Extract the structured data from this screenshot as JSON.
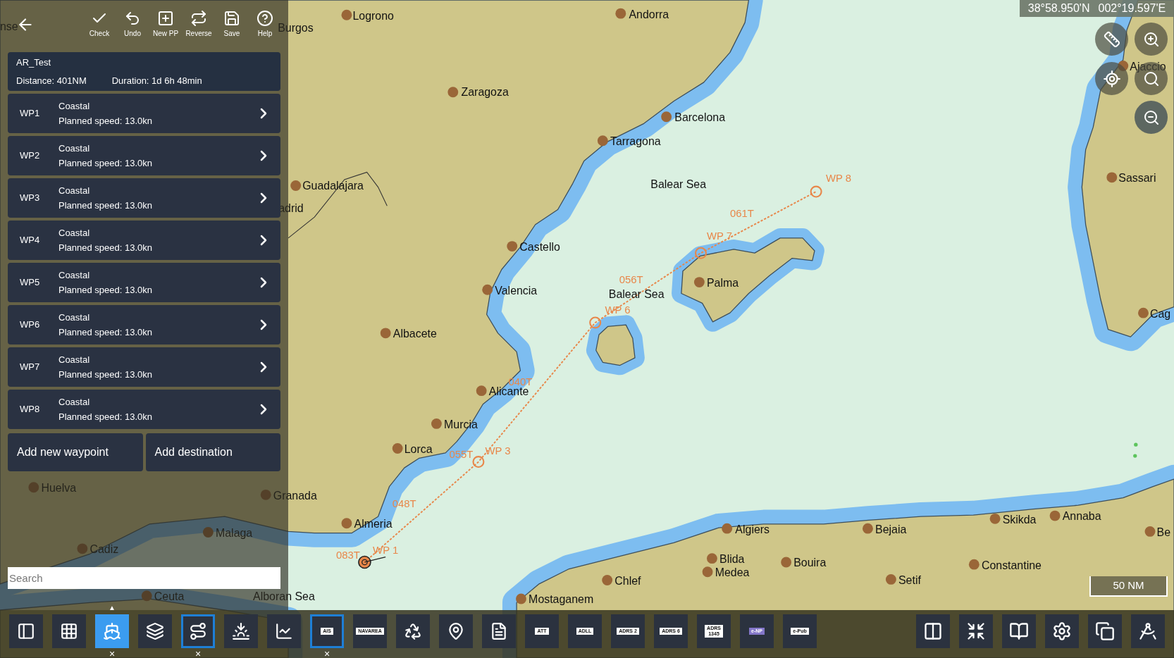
{
  "toolbar": {
    "buttons": [
      {
        "label": "Check"
      },
      {
        "label": "Undo"
      },
      {
        "label": "New PP"
      },
      {
        "label": "Reverse"
      },
      {
        "label": "Save"
      },
      {
        "label": "Help"
      }
    ]
  },
  "route": {
    "name": "AR_Test",
    "distance": "Distance: 401NM",
    "duration": "Duration: 1d 6h 48min"
  },
  "waypoints": [
    {
      "name": "WP1",
      "type": "Coastal",
      "speed": "Planned speed: 13.0kn"
    },
    {
      "name": "WP2",
      "type": "Coastal",
      "speed": "Planned speed: 13.0kn"
    },
    {
      "name": "WP3",
      "type": "Coastal",
      "speed": "Planned speed: 13.0kn"
    },
    {
      "name": "WP4",
      "type": "Coastal",
      "speed": "Planned speed: 13.0kn"
    },
    {
      "name": "WP5",
      "type": "Coastal",
      "speed": "Planned speed: 13.0kn"
    },
    {
      "name": "WP6",
      "type": "Coastal",
      "speed": "Planned speed: 13.0kn"
    },
    {
      "name": "WP7",
      "type": "Coastal",
      "speed": "Planned speed: 13.0kn"
    },
    {
      "name": "WP8",
      "type": "Coastal",
      "speed": "Planned speed: 13.0kn"
    }
  ],
  "actions": [
    "Add new waypoint",
    "Add destination"
  ],
  "search": {
    "placeholder": "Search"
  },
  "position": {
    "latitude": "38°58.950'N",
    "longitude": "002°19.597'E"
  },
  "map": {
    "places": [
      {
        "name": "Logrono",
        "kind": "city"
      },
      {
        "name": "Andorra",
        "kind": "city"
      },
      {
        "name": "Burgos",
        "kind": "label"
      },
      {
        "name": "nse",
        "kind": "label"
      },
      {
        "name": "Ajaccio",
        "kind": "city"
      },
      {
        "name": "Zaragoza",
        "kind": "city"
      },
      {
        "name": "Barcelona",
        "kind": "city"
      },
      {
        "name": "Tarragona",
        "kind": "city"
      },
      {
        "name": "Guadalajara",
        "kind": "city"
      },
      {
        "name": "adrid",
        "kind": "label"
      },
      {
        "name": "Castello",
        "kind": "city"
      },
      {
        "name": "Valencia",
        "kind": "city"
      },
      {
        "name": "Albacete",
        "kind": "city"
      },
      {
        "name": "Alicante",
        "kind": "city"
      },
      {
        "name": "Murcia",
        "kind": "city"
      },
      {
        "name": "Lorca",
        "kind": "city"
      },
      {
        "name": "Granada",
        "kind": "city"
      },
      {
        "name": "Huelva",
        "kind": "city"
      },
      {
        "name": "Almeria",
        "kind": "city"
      },
      {
        "name": "Malaga",
        "kind": "city"
      },
      {
        "name": "Cadiz",
        "kind": "city"
      },
      {
        "name": "Ceuta",
        "kind": "city"
      },
      {
        "name": "Alboran Sea",
        "kind": "sea"
      },
      {
        "name": "Mostaganem",
        "kind": "city"
      },
      {
        "name": "Chlef",
        "kind": "city"
      },
      {
        "name": "Blida",
        "kind": "city"
      },
      {
        "name": "Medea",
        "kind": "city"
      },
      {
        "name": "Algiers",
        "kind": "city"
      },
      {
        "name": "Bouira",
        "kind": "city"
      },
      {
        "name": "Bejaia",
        "kind": "city"
      },
      {
        "name": "Setif",
        "kind": "city"
      },
      {
        "name": "Constantine",
        "kind": "city"
      },
      {
        "name": "Skikda",
        "kind": "city"
      },
      {
        "name": "Annaba",
        "kind": "city"
      },
      {
        "name": "Be",
        "kind": "city"
      },
      {
        "name": "Sassari",
        "kind": "city"
      },
      {
        "name": "Cag",
        "kind": "city"
      },
      {
        "name": "Palma",
        "kind": "city"
      },
      {
        "name": "Balear Sea",
        "kind": "sea"
      },
      {
        "name": "Balear Sea",
        "kind": "sea"
      }
    ],
    "route_labels": [
      "083T",
      "WP 1",
      "048T",
      "055T",
      "WP 3",
      "040T",
      "WP 6",
      "056T",
      "WP 7",
      "061T",
      "WP 8"
    ]
  },
  "scale": "50 NM",
  "bottom_toolbar": {
    "left": [
      {
        "kind": "icon",
        "selected": false,
        "active": false
      },
      {
        "kind": "icon",
        "selected": false,
        "active": false
      },
      {
        "kind": "icon",
        "selected": true,
        "active": false,
        "above": "▲",
        "close": "×"
      },
      {
        "kind": "icon",
        "selected": false,
        "active": false
      },
      {
        "kind": "icon",
        "selected": false,
        "active": true,
        "close": "×"
      },
      {
        "kind": "icon",
        "selected": false,
        "active": false
      },
      {
        "kind": "icon",
        "selected": false,
        "active": false
      },
      {
        "kind": "tag",
        "label": "AIS",
        "color": "#ffffff",
        "selected": false,
        "active": true,
        "close": "×"
      },
      {
        "kind": "tag",
        "label": "NAVAREA",
        "color": "#ffffff",
        "selected": false,
        "active": false
      },
      {
        "kind": "icon",
        "selected": false,
        "active": false
      },
      {
        "kind": "icon",
        "selected": false,
        "active": false
      },
      {
        "kind": "icon",
        "selected": false,
        "active": false
      },
      {
        "kind": "tag",
        "label": "ATT",
        "color": "#ffffff",
        "selected": false,
        "active": false
      },
      {
        "kind": "tag",
        "label": "ADLL",
        "color": "#ffffff",
        "selected": false,
        "active": false
      },
      {
        "kind": "tag",
        "label": "ADRS 2",
        "color": "#ffffff",
        "selected": false,
        "active": false
      },
      {
        "kind": "tag",
        "label": "ADRS 6",
        "color": "#ffffff",
        "selected": false,
        "active": false
      },
      {
        "kind": "tag",
        "label": "ADRS\n1345",
        "color": "#ffffff",
        "selected": false,
        "active": false
      },
      {
        "kind": "tag",
        "label": "e-NP",
        "color": "#8477c9",
        "selected": false,
        "active": false
      },
      {
        "kind": "tag",
        "label": "e-Pub",
        "color": "#ffffff",
        "selected": false,
        "active": false
      }
    ],
    "right": [
      {
        "kind": "icon"
      },
      {
        "kind": "icon"
      },
      {
        "kind": "icon"
      },
      {
        "kind": "icon"
      },
      {
        "kind": "icon"
      },
      {
        "kind": "icon"
      }
    ]
  }
}
